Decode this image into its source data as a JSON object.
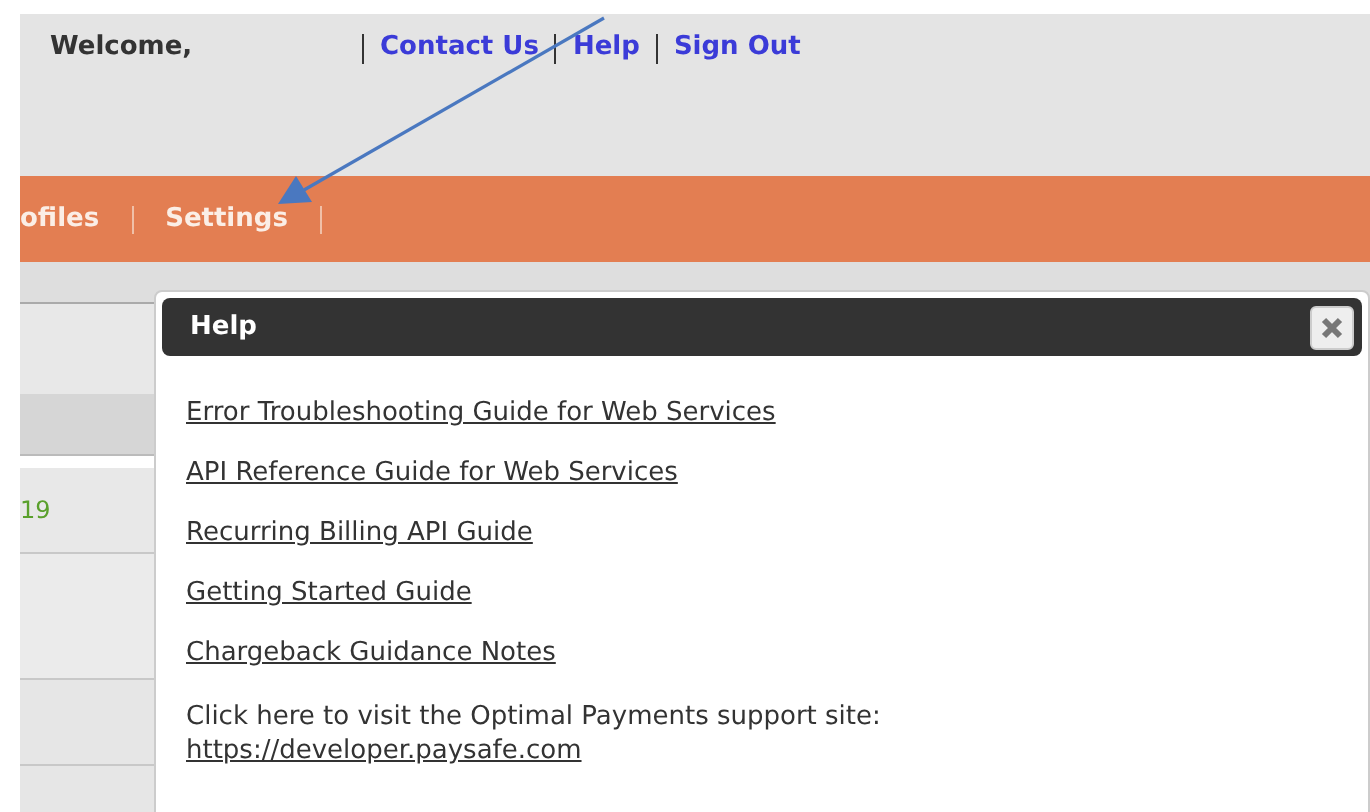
{
  "header": {
    "welcome": "Welcome,",
    "links": [
      {
        "label": "Contact Us"
      },
      {
        "label": "Help"
      },
      {
        "label": "Sign Out"
      }
    ]
  },
  "nav": {
    "items": [
      {
        "label": "ofiles"
      },
      {
        "label": "Settings"
      }
    ]
  },
  "background_rows": [
    {
      "text": ""
    },
    {
      "text": "19"
    }
  ],
  "dialog": {
    "title": "Help",
    "links": [
      {
        "label": "Error Troubleshooting Guide for Web Services"
      },
      {
        "label": "API Reference Guide for Web Services"
      },
      {
        "label": "Recurring Billing API Guide"
      },
      {
        "label": "Getting Started Guide"
      },
      {
        "label": "Chargeback Guidance Notes"
      }
    ],
    "support_text": "Click here to visit the Optimal Payments support site:",
    "support_link": "https://developer.paysafe.com"
  }
}
